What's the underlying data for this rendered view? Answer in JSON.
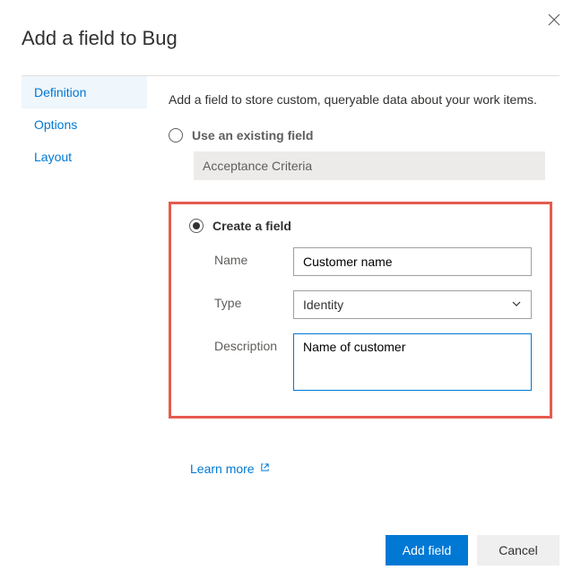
{
  "dialog": {
    "title": "Add a field to Bug",
    "intro": "Add a field to store custom, queryable data about your work items."
  },
  "sidebar": {
    "items": [
      {
        "label": "Definition",
        "active": true
      },
      {
        "label": "Options",
        "active": false
      },
      {
        "label": "Layout",
        "active": false
      }
    ]
  },
  "options": {
    "existing": {
      "label": "Use an existing field",
      "value": "Acceptance Criteria",
      "selected": false
    },
    "create": {
      "label": "Create a field",
      "selected": true,
      "fields": {
        "name_label": "Name",
        "name_value": "Customer name",
        "type_label": "Type",
        "type_value": "Identity",
        "description_label": "Description",
        "description_value": "Name of customer"
      }
    }
  },
  "links": {
    "learn_more": "Learn more"
  },
  "footer": {
    "primary": "Add field",
    "cancel": "Cancel"
  }
}
